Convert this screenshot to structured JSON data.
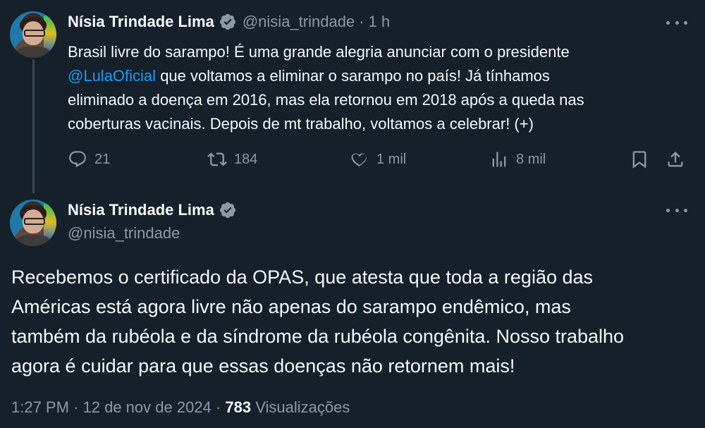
{
  "tweet1": {
    "author_name": "Nísia Trindade Lima",
    "handle": "@nisia_trindade",
    "separator": "·",
    "time": "1 h",
    "text_lines": [
      "Brasil livre do sarampo! É uma grande alegria anunciar com o presidente",
      "que voltamos a eliminar o sarampo no país! Já tínhamos",
      "eliminado a doença em 2016, mas ela retornou em 2018 após a queda nas",
      "coberturas vacinais. Depois de mt trabalho, voltamos a celebrar! (+)"
    ],
    "mention": "@LulaOficial",
    "actions": {
      "reply_count": "21",
      "retweet_count": "184",
      "like_count": "1 mil",
      "views_count": "8 mil"
    }
  },
  "tweet2": {
    "author_name": "Nísia Trindade Lima",
    "handle": "@nisia_trindade",
    "text_lines": [
      "Recebemos o certificado da OPAS, que atesta que toda a região das",
      "Américas está agora livre não apenas do sarampo endêmico, mas",
      "também da rubéola e da síndrome da rubéola congênita. Nosso trabalho",
      "agora é cuidar para que essas doenças não retornem mais!"
    ],
    "time": "1:27 PM",
    "separator1": "·",
    "date": "12 de nov de 2024",
    "separator2": "·",
    "views_count": "783",
    "views_label": "Visualizações"
  },
  "icons": {
    "verified": "verified-badge-icon",
    "more": "more-icon",
    "reply": "reply-icon",
    "retweet": "retweet-icon",
    "like": "heart-icon",
    "views": "views-icon",
    "bookmark": "bookmark-icon",
    "share": "share-icon"
  },
  "colors": {
    "background": "#15202b",
    "text": "#f7f9f9",
    "secondary": "#8b98a5",
    "link": "#1d9bf0"
  }
}
